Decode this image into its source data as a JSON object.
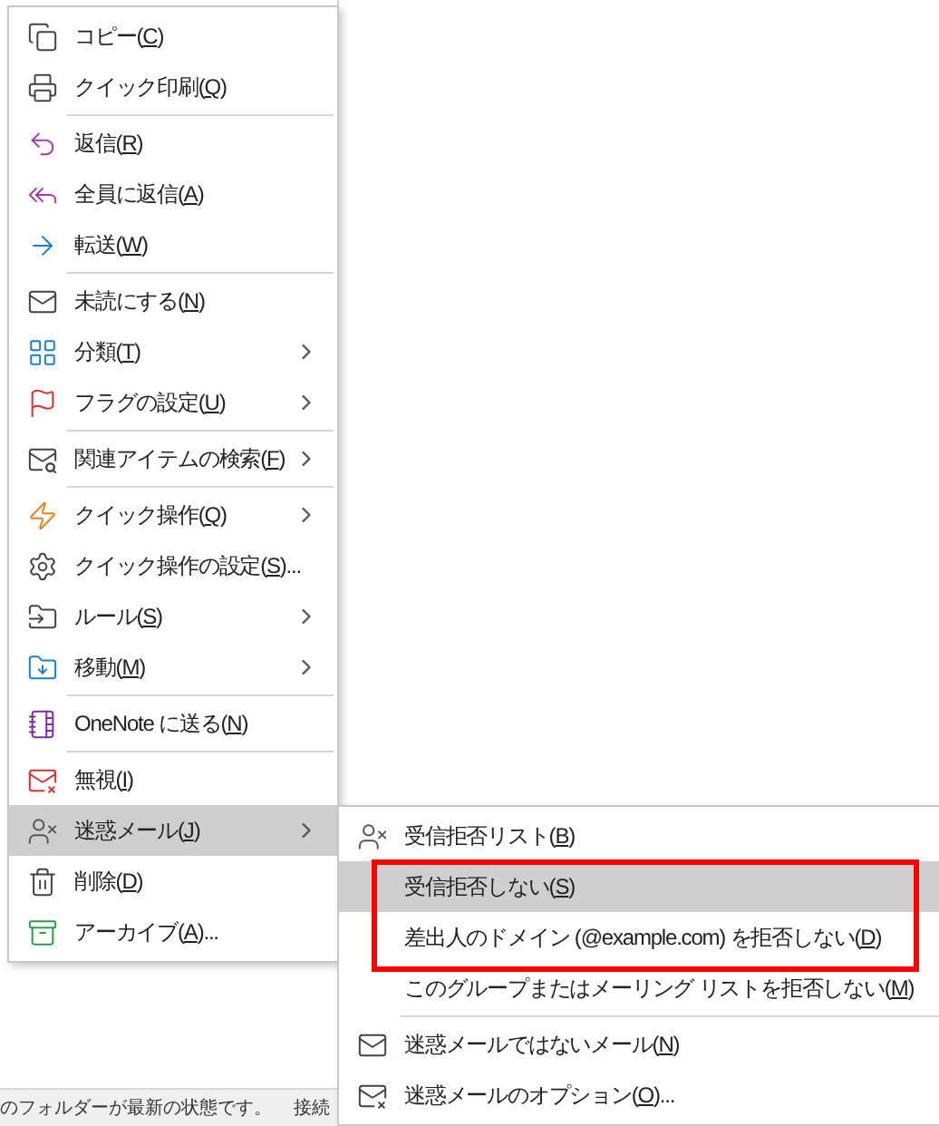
{
  "status_bar": {
    "left": "のフォルダーが最新の状態です。",
    "right": "接続"
  },
  "context_menu": {
    "groups": [
      [
        {
          "label": "コピー(C)",
          "submenu": false,
          "selected": false
        },
        {
          "label": "クイック印刷(Q)",
          "submenu": false,
          "selected": false
        }
      ],
      [
        {
          "label": "返信(R)",
          "submenu": false,
          "selected": false
        },
        {
          "label": "全員に返信(A)",
          "submenu": false,
          "selected": false
        },
        {
          "label": "転送(W)",
          "submenu": false,
          "selected": false
        }
      ],
      [
        {
          "label": "未読にする(N)",
          "submenu": false,
          "selected": false
        },
        {
          "label": "分類(T)",
          "submenu": true,
          "selected": false
        },
        {
          "label": "フラグの設定(U)",
          "submenu": true,
          "selected": false
        }
      ],
      [
        {
          "label": "関連アイテムの検索(F)",
          "submenu": true,
          "selected": false
        }
      ],
      [
        {
          "label": "クイック操作(Q)",
          "submenu": true,
          "selected": false
        },
        {
          "label": "クイック操作の設定(S)...",
          "submenu": false,
          "selected": false
        },
        {
          "label": "ルール(S)",
          "submenu": true,
          "selected": false
        },
        {
          "label": "移動(M)",
          "submenu": true,
          "selected": false
        }
      ],
      [
        {
          "label": "OneNote に送る(N)",
          "submenu": false,
          "selected": false
        }
      ],
      [
        {
          "label": "無視(I)",
          "submenu": false,
          "selected": false
        },
        {
          "label": "迷惑メール(J)",
          "submenu": true,
          "selected": true
        },
        {
          "label": "削除(D)",
          "submenu": false,
          "selected": false
        },
        {
          "label": "アーカイブ(A)...",
          "submenu": false,
          "selected": false
        }
      ]
    ]
  },
  "junk_submenu": {
    "groups": [
      [
        {
          "framed": false,
          "items": [
            {
              "label": "受信拒否リスト(B)",
              "selected": false
            }
          ]
        },
        {
          "framed": true,
          "items": [
            {
              "label": "受信拒否しない(S)",
              "selected": true
            },
            {
              "label": "差出人のドメイン (@example.com) を拒否しない(D)",
              "selected": false
            }
          ]
        },
        {
          "framed": false,
          "items": [
            {
              "label": "このグループまたはメーリング リストを拒否しない(M)",
              "selected": false
            }
          ]
        }
      ],
      [
        {
          "framed": false,
          "items": [
            {
              "label": "迷惑メールではないメール(N)",
              "selected": false
            },
            {
              "label": "迷惑メールのオプション(O)...",
              "selected": false
            }
          ]
        }
      ]
    ]
  }
}
